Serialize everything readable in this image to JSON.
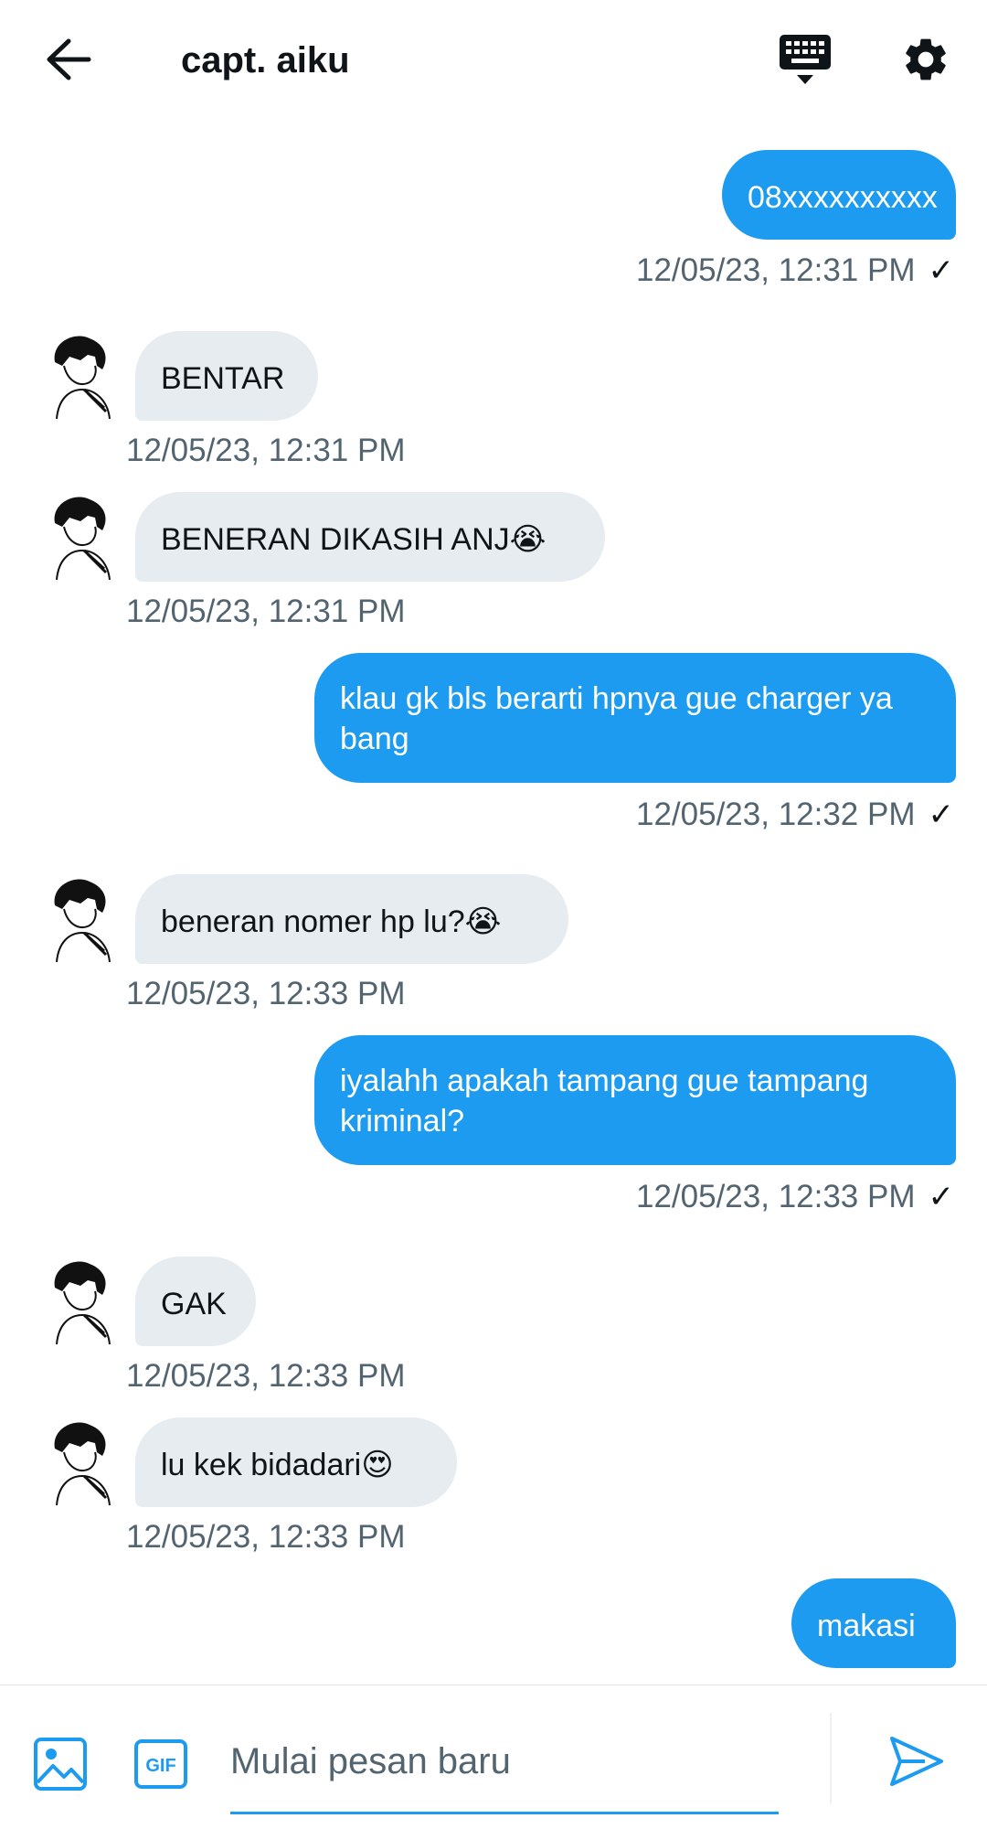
{
  "header": {
    "title": "capt. aiku",
    "back_icon": "arrow-left-icon",
    "keyboard_icon": "keyboard-icon",
    "settings_icon": "gear-icon"
  },
  "messages": [
    {
      "direction": "out",
      "text": "08xxxxxxxxxx",
      "time": "12/05/23, 12:31 PM",
      "check": "✓"
    },
    {
      "direction": "in",
      "text": "BENTAR",
      "time": "12/05/23, 12:31 PM"
    },
    {
      "direction": "in",
      "text": "BENERAN DIKASIH ANJ😭",
      "time": "12/05/23, 12:31 PM"
    },
    {
      "direction": "out",
      "text": "klau gk bls berarti hpnya gue charger ya bang",
      "time": "12/05/23, 12:32 PM",
      "check": "✓"
    },
    {
      "direction": "in",
      "text": "beneran nomer hp lu?😭",
      "time": "12/05/23, 12:33 PM"
    },
    {
      "direction": "out",
      "text": "iyalahh apakah tampang gue tampang kriminal?",
      "time": "12/05/23, 12:33 PM",
      "check": "✓"
    },
    {
      "direction": "in",
      "text": "GAK",
      "time": "12/05/23, 12:33 PM"
    },
    {
      "direction": "in",
      "text": "lu kek bidadari😍",
      "time": "12/05/23, 12:33 PM"
    },
    {
      "direction": "out",
      "text": "makasi"
    }
  ],
  "composer": {
    "placeholder": "Mulai pesan baru",
    "image_icon": "image-icon",
    "gif_label": "GIF",
    "send_icon": "send-icon"
  },
  "colors": {
    "accent": "#1d9bf0",
    "incoming_bubble": "#e7ecf0",
    "timestamp": "#536471"
  }
}
